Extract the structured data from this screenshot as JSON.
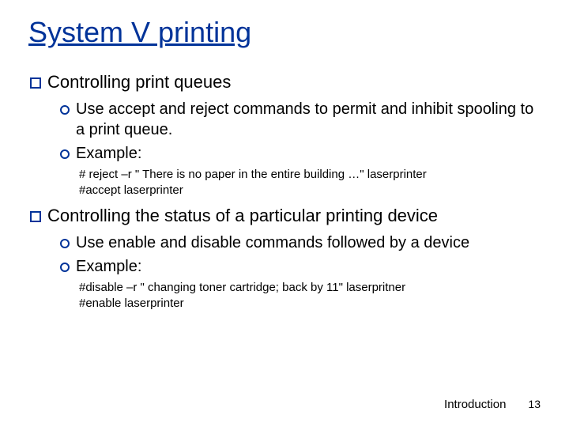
{
  "title": "System V printing",
  "section1": {
    "heading": "Controlling print queues",
    "bullet1": "Use accept and reject commands to permit and inhibit spooling to a print queue.",
    "bullet2": "Example:",
    "code1": "# reject –r \" There is no paper in the entire building …\" laserprinter",
    "code2": "#accept laserprinter"
  },
  "section2": {
    "heading": "Controlling the status of a particular printing device",
    "bullet1": "Use enable and disable commands followed by a device",
    "bullet2": "Example:",
    "code1": "#disable –r \" changing toner cartridge; back by 11\" laserpritner",
    "code2": "#enable laserprinter"
  },
  "footer": {
    "label": "Introduction",
    "page": "13"
  }
}
